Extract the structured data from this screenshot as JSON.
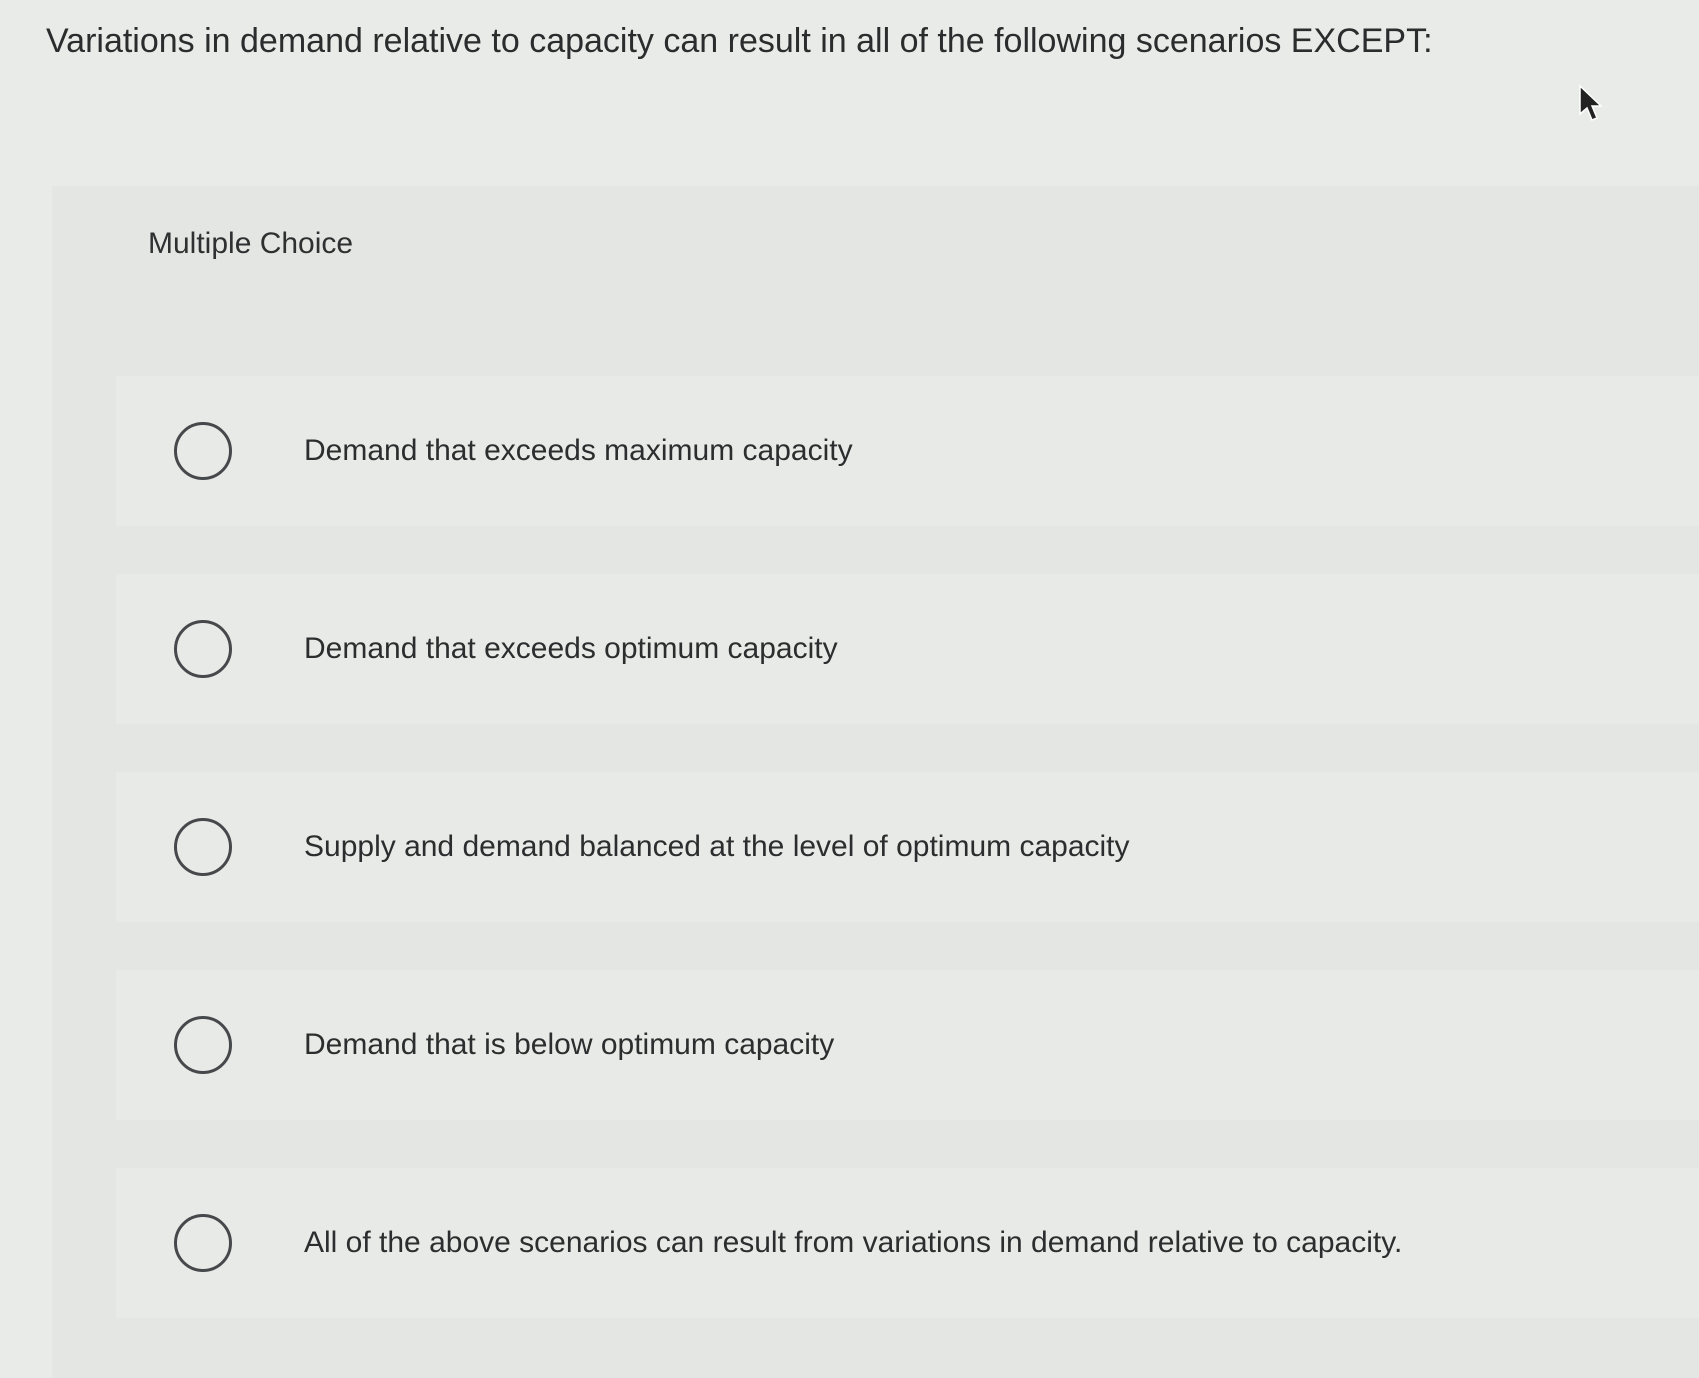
{
  "question": {
    "text": "Variations in demand relative to capacity can result in all of the following scenarios EXCEPT:"
  },
  "panel": {
    "label": "Multiple Choice"
  },
  "choices": [
    {
      "text": "Demand that exceeds maximum capacity",
      "selected": false
    },
    {
      "text": "Demand that exceeds optimum capacity",
      "selected": false
    },
    {
      "text": "Supply and demand balanced at the level of optimum capacity",
      "selected": false
    },
    {
      "text": "Demand that is below optimum capacity",
      "selected": false
    },
    {
      "text": "All of the above scenarios can result from variations in demand relative to capacity.",
      "selected": false
    }
  ],
  "cursor": {
    "icon": "mouse-pointer-icon"
  }
}
